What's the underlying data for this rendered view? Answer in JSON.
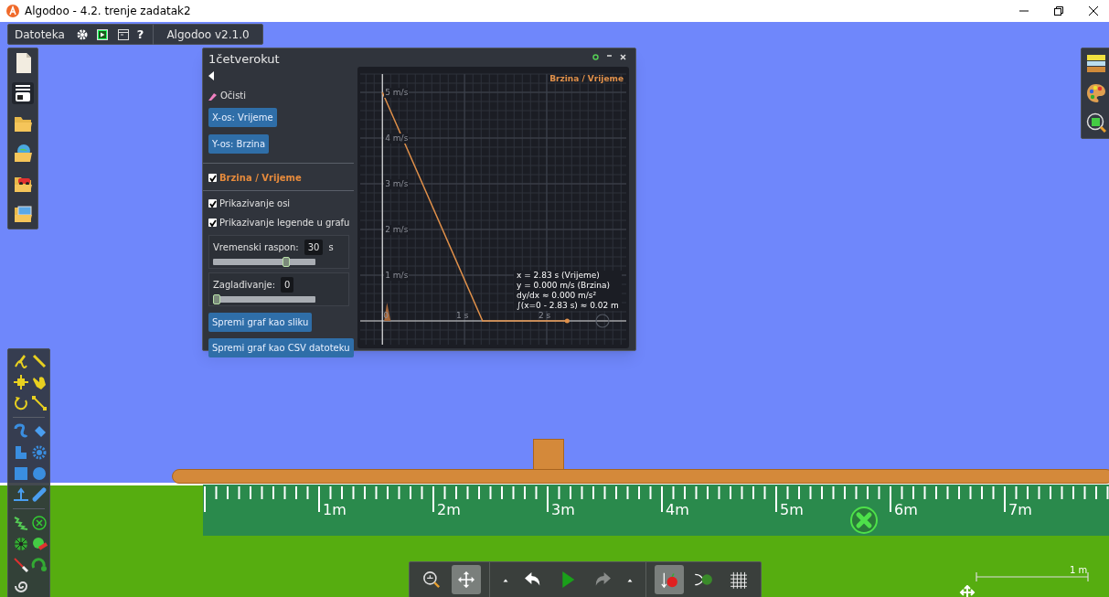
{
  "window": {
    "title": "Algodoo - 4.2. trenje zadatak2"
  },
  "menubar": {
    "menu": "Datoteka",
    "help": "?",
    "version": "Algodoo v2.1.0"
  },
  "left_toolbar": [
    {
      "kind": "new",
      "selected": false
    },
    {
      "kind": "toolbox",
      "selected": true
    },
    {
      "kind": "open",
      "selected": false
    },
    {
      "kind": "scenes",
      "selected": false
    },
    {
      "kind": "lessons",
      "selected": false
    },
    {
      "kind": "browse",
      "selected": false
    }
  ],
  "graph_window": {
    "title": "1četverokut",
    "clear": "Očisti",
    "axis_buttons": [
      "X-os: Vrijeme",
      "Y-os: Brzina"
    ],
    "series_list": [
      {
        "label": "Brzina / Vrijeme",
        "checked": true
      }
    ],
    "options": [
      {
        "label": "Prikazivanje osi",
        "checked": true
      },
      {
        "label": "Prikazivanje legende u grafu",
        "checked": true
      }
    ],
    "sliders": [
      {
        "label": "Vremenski raspon:",
        "value": "30",
        "unit": "s",
        "level": 0.73
      },
      {
        "label": "Zaglađivanje:",
        "value": "0",
        "level": 0
      }
    ],
    "buttons": [
      "Spremi graf kao sliku",
      "Spremi graf kao CSV datoteku"
    ],
    "chart_data": {
      "type": "line",
      "grid": true,
      "x": [
        0,
        1.22,
        2.25
      ],
      "series": [
        {
          "name": "Brzina / Vrijeme",
          "color": "#e0904a",
          "values": [
            5,
            0,
            0
          ]
        }
      ],
      "xlim": [
        -0.27,
        2.97
      ],
      "ylim": [
        -0.52,
        5.4
      ],
      "xticks": [
        {
          "value": 0,
          "label": "0"
        },
        {
          "value": 1,
          "label": "1 s"
        },
        {
          "value": 2,
          "label": "2 s"
        }
      ],
      "yticks": [
        {
          "value": 1,
          "label": "1 m/s"
        },
        {
          "value": 2,
          "label": "2 m/s"
        },
        {
          "value": 3,
          "label": "3 m/s"
        },
        {
          "value": 4,
          "label": "4 m/s"
        },
        {
          "value": 5,
          "label": "5 m/s"
        }
      ]
    },
    "readout": [
      "x = 2.83 s (Vrijeme)",
      "y = 0.000 m/s (Brzina)",
      "dy/dx ≈ 0.000 m/s²",
      "∫(x=0 - 2.83 s) ≈ 0.02 m"
    ]
  },
  "ruler": [
    "1m",
    "2m",
    "3m",
    "4m",
    "5m",
    "6m",
    "7m"
  ],
  "scale_bar": "1 m",
  "bottom_toolbar": [
    {
      "kind": "zoom",
      "on": false
    },
    {
      "kind": "pan",
      "on": true
    },
    {
      "kind": "caret",
      "on": false
    },
    {
      "kind": "undo",
      "on": false
    },
    {
      "kind": "play",
      "on": false
    },
    {
      "kind": "redo",
      "on": false
    },
    {
      "kind": "caret",
      "on": false
    },
    {
      "kind": "gravity",
      "on": true
    },
    {
      "kind": "air",
      "on": false
    },
    {
      "kind": "grid",
      "on": false
    }
  ]
}
